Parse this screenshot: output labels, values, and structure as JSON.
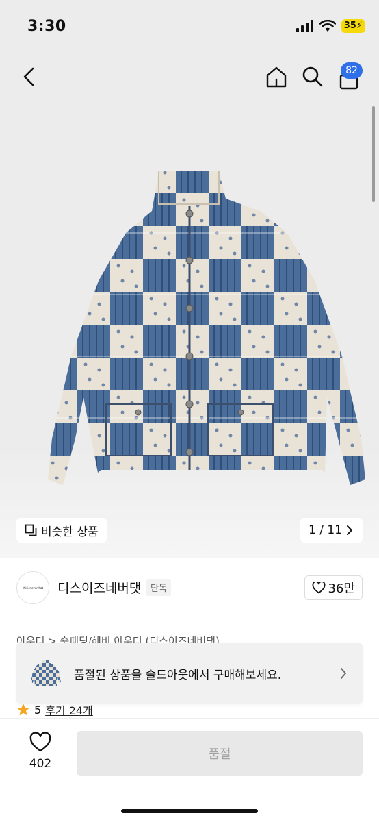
{
  "status": {
    "time": "3:30",
    "battery": "35"
  },
  "header": {
    "cart_count": "82"
  },
  "gallery": {
    "similar_label": "비슷한 상품",
    "page": "1 / 11"
  },
  "brand": {
    "logo_text": "thisisneverthat",
    "name": "디스이즈네버댓",
    "badge": "단독",
    "likes": "36만"
  },
  "category": {
    "breadcrumb": "아우터 > 숏패딩/헤비 아우터 (디스이즈네버댓)"
  },
  "rating": {
    "score": "5",
    "reviews": "후기 24개"
  },
  "banner": {
    "text": "품절된 상품을 솔드아웃에서 구매해보세요."
  },
  "bottom": {
    "wish_count": "402",
    "buy_label": "품절"
  },
  "colors": {
    "accent": "#2f6fe8",
    "battery": "#f5d90a",
    "star": "#f5a623",
    "disabled_btn": "#e8e8e8"
  },
  "icons": [
    "back-icon",
    "home-icon",
    "search-icon",
    "cart-icon",
    "similar-icon",
    "chevron-right-icon",
    "heart-icon",
    "star-icon"
  ]
}
